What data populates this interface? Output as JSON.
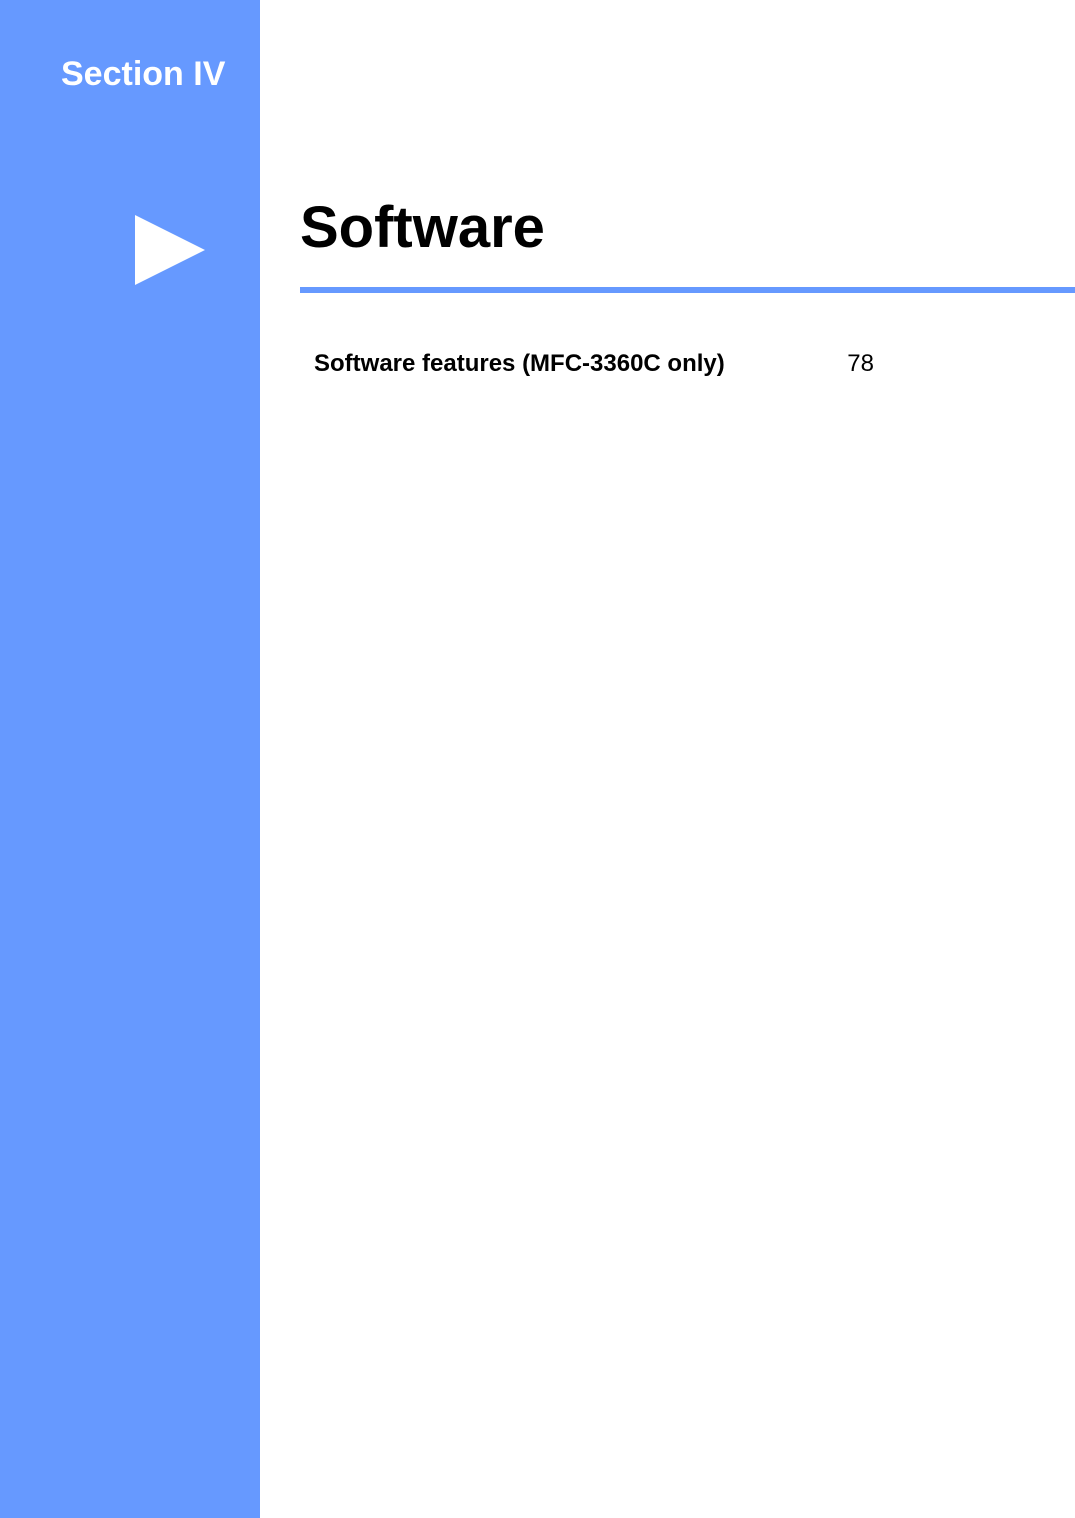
{
  "section": {
    "label": "Section IV"
  },
  "title": "Software",
  "toc": {
    "entries": [
      {
        "title": "Software features (MFC-3360C only)",
        "page": "78"
      }
    ]
  },
  "colors": {
    "accent": "#6699ff"
  }
}
